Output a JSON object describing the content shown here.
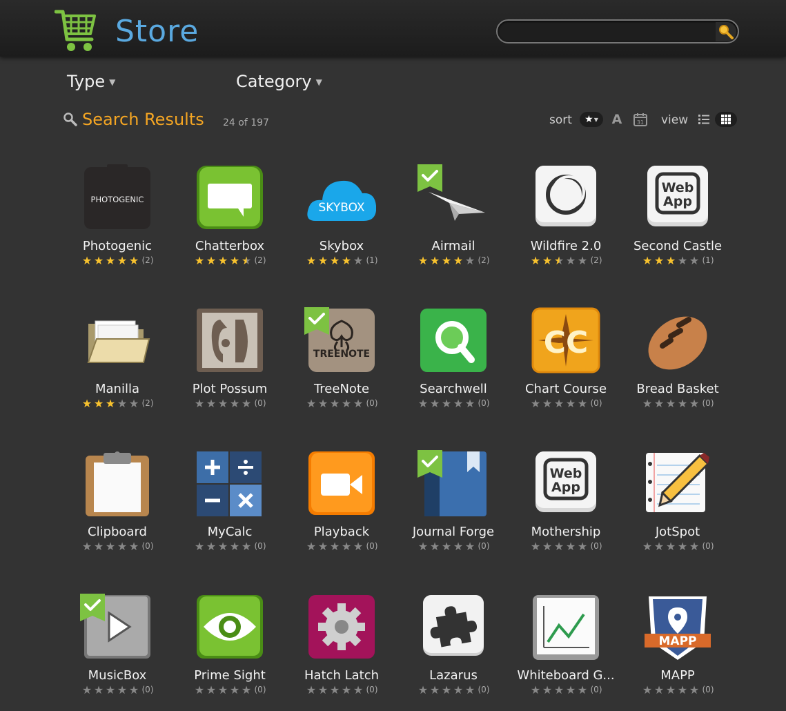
{
  "header": {
    "title": "Store",
    "search": {
      "value": "",
      "placeholder": ""
    }
  },
  "filters": {
    "type_label": "Type",
    "category_label": "Category"
  },
  "results": {
    "title": "Search Results",
    "count": "24 of 197"
  },
  "toolbar": {
    "sort_label": "sort",
    "sort_alpha_glyph": "A",
    "sort_date_glyph": "31",
    "view_label": "view",
    "active_sort": "rating",
    "active_view": "grid"
  },
  "colors": {
    "accent": "#f5a623",
    "title_blue": "#5aa9e0",
    "star": "#f8c22e",
    "installed_badge": "#7dc242"
  },
  "apps": [
    {
      "name": "Photogenic",
      "rating": 5,
      "count": "(2)",
      "icon": "photogenic-icon",
      "installed": false
    },
    {
      "name": "Chatterbox",
      "rating": 4.5,
      "count": "(2)",
      "icon": "chat-bubble-icon",
      "installed": false
    },
    {
      "name": "Skybox",
      "rating": 4,
      "count": "(1)",
      "icon": "cloud-icon",
      "installed": false
    },
    {
      "name": "Airmail",
      "rating": 4,
      "count": "(2)",
      "icon": "paper-plane-icon",
      "installed": true
    },
    {
      "name": "Wildfire 2.0",
      "rating": 2.5,
      "count": "(2)",
      "icon": "wildfire-icon",
      "installed": false
    },
    {
      "name": "Second Castle",
      "rating": 3,
      "count": "(1)",
      "icon": "web-app-icon",
      "installed": false
    },
    {
      "name": "Manilla",
      "rating": 3,
      "count": "(2)",
      "icon": "folder-icon",
      "installed": false
    },
    {
      "name": "Plot Possum",
      "rating": 0,
      "count": "(0)",
      "icon": "plot-possum-icon",
      "installed": false
    },
    {
      "name": "TreeNote",
      "rating": 0,
      "count": "(0)",
      "icon": "treenote-icon",
      "installed": true
    },
    {
      "name": "Searchwell",
      "rating": 0,
      "count": "(0)",
      "icon": "magnifier-icon",
      "installed": false
    },
    {
      "name": "Chart Course",
      "rating": 0,
      "count": "(0)",
      "icon": "compass-icon",
      "installed": false
    },
    {
      "name": "Bread Basket",
      "rating": 0,
      "count": "(0)",
      "icon": "bread-icon",
      "installed": false
    },
    {
      "name": "Clipboard",
      "rating": 0,
      "count": "(0)",
      "icon": "clipboard-icon",
      "installed": false
    },
    {
      "name": "MyCalc",
      "rating": 0,
      "count": "(0)",
      "icon": "calculator-icon",
      "installed": false
    },
    {
      "name": "Playback",
      "rating": 0,
      "count": "(0)",
      "icon": "video-camera-icon",
      "installed": false
    },
    {
      "name": "Journal Forge",
      "rating": 0,
      "count": "(0)",
      "icon": "journal-icon",
      "installed": true
    },
    {
      "name": "Mothership",
      "rating": 0,
      "count": "(0)",
      "icon": "web-app-icon",
      "installed": false
    },
    {
      "name": "JotSpot",
      "rating": 0,
      "count": "(0)",
      "icon": "notepad-pencil-icon",
      "installed": false
    },
    {
      "name": "MusicBox",
      "rating": 0,
      "count": "(0)",
      "icon": "play-icon",
      "installed": true
    },
    {
      "name": "Prime Sight",
      "rating": 0,
      "count": "(0)",
      "icon": "eye-icon",
      "installed": false
    },
    {
      "name": "Hatch Latch",
      "rating": 0,
      "count": "(0)",
      "icon": "gear-icon",
      "installed": false
    },
    {
      "name": "Lazarus",
      "rating": 0,
      "count": "(0)",
      "icon": "puzzle-icon",
      "installed": false
    },
    {
      "name": "Whiteboard G...",
      "rating": 0,
      "count": "(0)",
      "icon": "whiteboard-chart-icon",
      "installed": false
    },
    {
      "name": "MAPP",
      "rating": 0,
      "count": "(0)",
      "icon": "map-pin-icon",
      "installed": false
    }
  ],
  "icon_text": {
    "photogenic": "PHOTOGENIC",
    "skybox": "SKYBOX",
    "web_app": "Web App",
    "treenote": "TREENOTE",
    "mapp": "MAPP"
  }
}
